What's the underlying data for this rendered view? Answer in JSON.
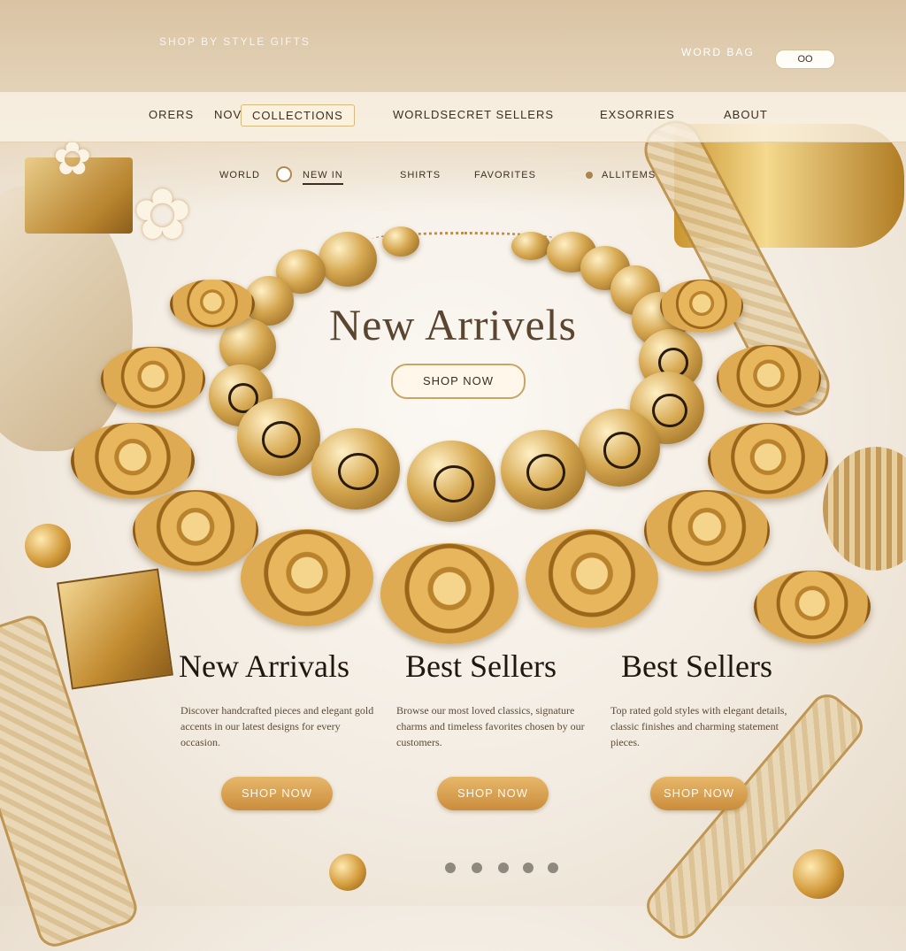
{
  "header": {
    "ghost_nav": "SHOP BY STYLE  GIFTS",
    "brand_row": "WORD BAG",
    "cart_label": "OO"
  },
  "nav": {
    "items": [
      {
        "label": "ORERS"
      },
      {
        "label": "NOV"
      },
      {
        "label": "COLLECTIONS",
        "active": true
      },
      {
        "label": "WORLDSECRET SELLERS"
      },
      {
        "label": "EXSORRIES"
      },
      {
        "label": "ABOUT"
      }
    ]
  },
  "subnav": {
    "items": [
      {
        "label": "WORLD"
      },
      {
        "label": "NEW IN"
      },
      {
        "label": "SHIRTS"
      },
      {
        "label": "FAVORITES"
      },
      {
        "label": "ALLITEMS"
      }
    ]
  },
  "hero": {
    "title": "New Arrivels",
    "button_label": "SHOP NOW"
  },
  "columns": [
    {
      "title": "New Arrivals",
      "text": "Discover handcrafted pieces and elegant gold accents in our latest designs for every occasion.",
      "button_label": "SHOP NOW"
    },
    {
      "title": "Best Sellers",
      "text": "Browse our most loved classics, signature charms and timeless favorites chosen by our customers.",
      "button_label": "SHOP NOW"
    },
    {
      "title": "Best Sellers",
      "text": "Top rated gold styles with elegant details, classic finishes and charming statement pieces.",
      "button_label": "SHOP NOW"
    }
  ],
  "carousel": {
    "dot_count": 5,
    "active_index": 0
  },
  "colors": {
    "gold": "#c98d3c",
    "cream": "#fbf8f3",
    "dark_text": "#1e1810"
  }
}
